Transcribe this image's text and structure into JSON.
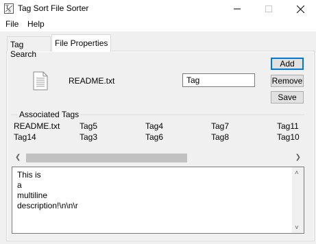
{
  "window": {
    "title": "Tag Sort File Sorter",
    "minimize_icon": "minimize-icon",
    "maximize_icon": "maximize-icon",
    "close_icon": "close-icon"
  },
  "menu": {
    "items": [
      "File",
      "Help"
    ]
  },
  "tabs": [
    {
      "label": "Tag Search",
      "selected": false
    },
    {
      "label": "File Properties",
      "selected": true
    }
  ],
  "file": {
    "name": "README.txt",
    "icon": "document-icon"
  },
  "tag_input": {
    "value": "Tag"
  },
  "buttons": {
    "add": "Add",
    "remove": "Remove",
    "save": "Save"
  },
  "associated_tags": {
    "title": "Associated Tags",
    "rows": [
      [
        "README.txt",
        "Tag5",
        "Tag4",
        "Tag7",
        "Tag11"
      ],
      [
        "Tag14",
        "Tag3",
        "Tag6",
        "Tag8",
        "Tag10"
      ]
    ]
  },
  "description": {
    "text": "This is\na\nmultiline\ndescription!\\n\\n\\r"
  },
  "colors": {
    "accent": "#0078d7",
    "background": "#f0f0f0"
  }
}
